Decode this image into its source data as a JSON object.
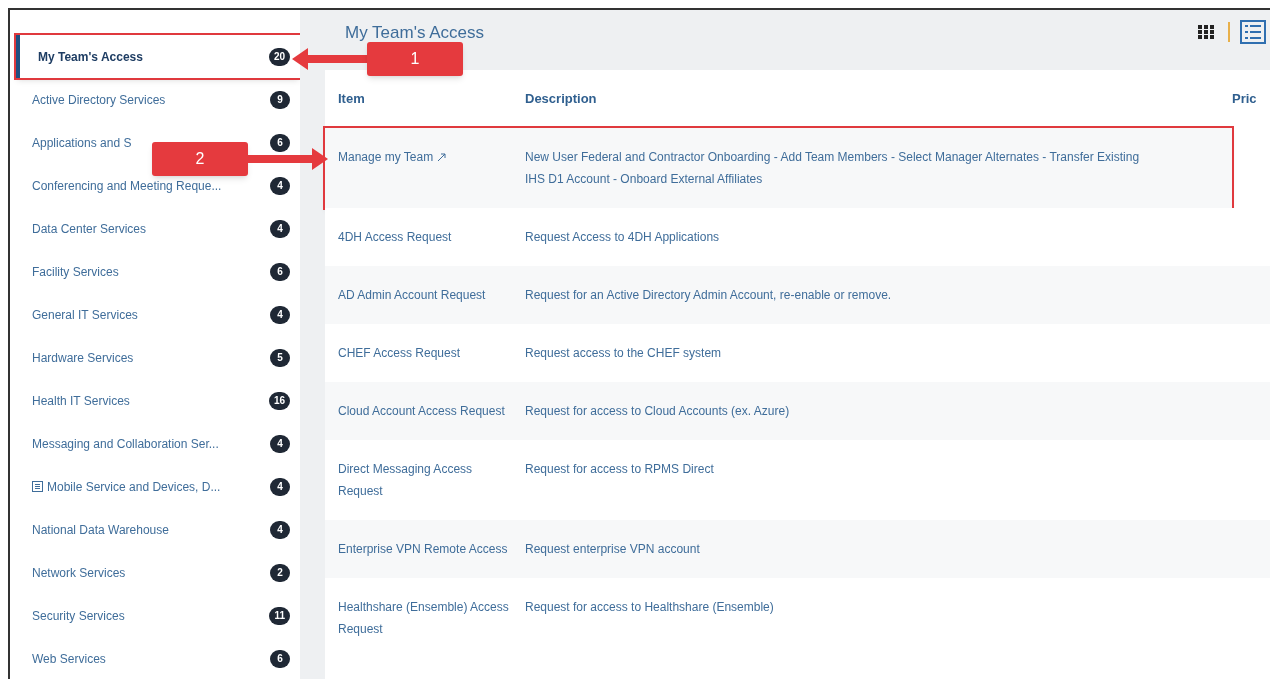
{
  "sidebar": {
    "items": [
      {
        "label": "My Team's Access",
        "count": "20",
        "selected": true,
        "highlighted": true
      },
      {
        "label": "Active Directory Services",
        "count": "9",
        "selected": false,
        "highlighted": false
      },
      {
        "label": "Applications and S",
        "count": "6",
        "selected": false,
        "highlighted": false
      },
      {
        "label": "Conferencing and Meeting Reque...",
        "count": "4",
        "selected": false,
        "highlighted": false
      },
      {
        "label": "Data Center Services",
        "count": "4",
        "selected": false,
        "highlighted": false
      },
      {
        "label": "Facility Services",
        "count": "6",
        "selected": false,
        "highlighted": false
      },
      {
        "label": "General IT Services",
        "count": "4",
        "selected": false,
        "highlighted": false
      },
      {
        "label": "Hardware Services",
        "count": "5",
        "selected": false,
        "highlighted": false
      },
      {
        "label": "Health IT Services",
        "count": "16",
        "selected": false,
        "highlighted": false
      },
      {
        "label": "Messaging and Collaboration Ser...",
        "count": "4",
        "selected": false,
        "highlighted": false
      },
      {
        "label": "Mobile Service and Devices, D...",
        "count": "4",
        "selected": false,
        "highlighted": false,
        "expandable": true
      },
      {
        "label": "National Data Warehouse",
        "count": "4",
        "selected": false,
        "highlighted": false
      },
      {
        "label": "Network Services",
        "count": "2",
        "selected": false,
        "highlighted": false
      },
      {
        "label": "Security Services",
        "count": "11",
        "selected": false,
        "highlighted": false
      },
      {
        "label": "Web Services",
        "count": "6",
        "selected": false,
        "highlighted": false
      }
    ]
  },
  "header": {
    "title": "My Team's Access",
    "views": [
      {
        "kind": "grid",
        "selected": false
      },
      {
        "kind": "list",
        "selected": true
      }
    ]
  },
  "table": {
    "columns": [
      "Item",
      "Description",
      "Pric"
    ],
    "rows": [
      {
        "item": "Manage my Team",
        "external": true,
        "highlighted": true,
        "description": "New User Federal and Contractor Onboarding - Add Team Members - Select Manager Alternates - Transfer Existing IHS D1 Account - Onboard External Affiliates"
      },
      {
        "item": "4DH Access Request",
        "external": false,
        "highlighted": false,
        "description": "Request Access to 4DH Applications"
      },
      {
        "item": "AD Admin Account Request",
        "external": false,
        "highlighted": false,
        "description": "Request for an Active Directory Admin Account, re-enable or remove."
      },
      {
        "item": "CHEF Access Request",
        "external": false,
        "highlighted": false,
        "description": "Request access to the CHEF system"
      },
      {
        "item": "Cloud Account Access Request",
        "external": false,
        "highlighted": false,
        "description": "Request for access to Cloud Accounts (ex. Azure)"
      },
      {
        "item": "Direct Messaging Access Request",
        "external": false,
        "highlighted": false,
        "description": "Request for access to RPMS Direct"
      },
      {
        "item": "Enterprise VPN Remote Access",
        "external": false,
        "highlighted": false,
        "description": "Request enterprise VPN account"
      },
      {
        "item": "Healthshare (Ensemble) Access Request",
        "external": false,
        "highlighted": false,
        "description": "Request for access to Healthshare (Ensemble)"
      }
    ]
  },
  "annotations": [
    {
      "label": "1"
    },
    {
      "label": "2"
    }
  ]
}
